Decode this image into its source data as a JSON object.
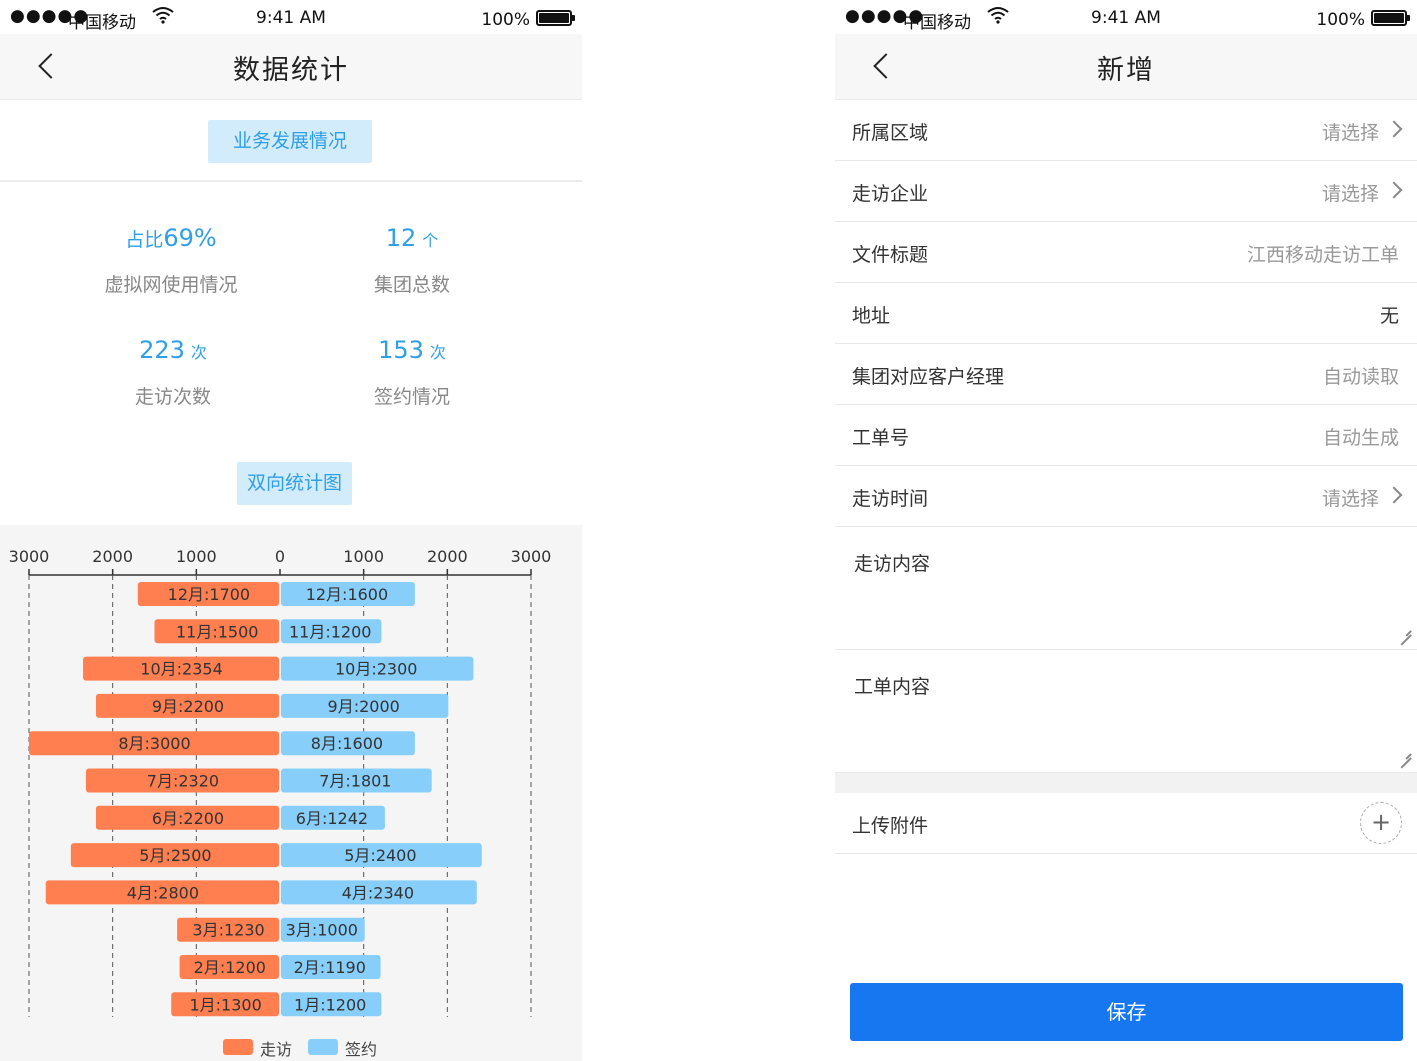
{
  "status": {
    "signal": "●●●●●",
    "carrier": "中国移动",
    "wifi": "⌔",
    "time": "9:41 AM",
    "battery": "100%"
  },
  "left": {
    "title": "数据统计",
    "section1": "业务发展情况",
    "stats": [
      {
        "prefix": "占比",
        "value": "69%",
        "unit": "",
        "label": "虚拟网使用情况"
      },
      {
        "prefix": "",
        "value": "12",
        "unit": "个",
        "label": "集团总数"
      },
      {
        "prefix": "",
        "value": "223",
        "unit": "次",
        "label": "走访次数"
      },
      {
        "prefix": "",
        "value": "153",
        "unit": "次",
        "label": "签约情况"
      }
    ],
    "section2": "双向统计图"
  },
  "chart_data": {
    "type": "bar",
    "orientation": "horizontal-bidirectional",
    "categories": [
      "12月",
      "11月",
      "10月",
      "9月",
      "8月",
      "7月",
      "6月",
      "5月",
      "4月",
      "3月",
      "2月",
      "1月"
    ],
    "series": [
      {
        "name": "走访",
        "color": "#ff7f50",
        "values": [
          1700,
          1500,
          2354,
          2200,
          3000,
          2320,
          2200,
          2500,
          2800,
          1230,
          1200,
          1300
        ]
      },
      {
        "name": "签约",
        "color": "#87cefa",
        "values": [
          1600,
          1200,
          2300,
          2000,
          1600,
          1801,
          1242,
          2400,
          2340,
          1000,
          1190,
          1200
        ]
      }
    ],
    "xticks": [
      "3000",
      "2000",
      "1000",
      "0",
      "1000",
      "2000",
      "3000"
    ],
    "xlim": [
      -3000,
      3000
    ],
    "grid": "dashed vertical",
    "legend": "bottom-center"
  },
  "right": {
    "title": "新增",
    "rows": [
      {
        "label": "所属区域",
        "value": "请选择",
        "arrow": true
      },
      {
        "label": "走访企业",
        "value": "请选择",
        "arrow": true
      },
      {
        "label": "文件标题",
        "value": "江西移动走访工单",
        "arrow": false
      },
      {
        "label": "地址",
        "value": "无",
        "arrow": false
      },
      {
        "label": "集团对应客户经理",
        "value": "自动读取",
        "arrow": false
      },
      {
        "label": "工单号",
        "value": "自动生成",
        "arrow": false
      },
      {
        "label": "走访时间",
        "value": "请选择",
        "arrow": true
      }
    ],
    "visit_content": "走访内容",
    "order_content": "工单内容",
    "upload": "上传附件",
    "plus": "+",
    "save": "保存"
  }
}
